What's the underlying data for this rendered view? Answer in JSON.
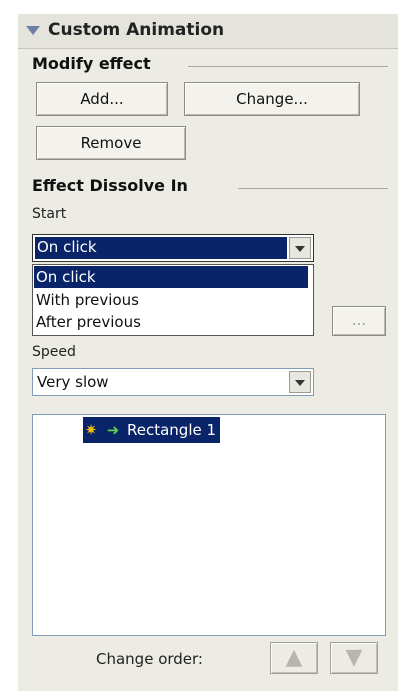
{
  "panel": {
    "title": "Custom Animation"
  },
  "modify_effect": {
    "title": "Modify effect",
    "add_button": "Add...",
    "change_button": "Change...",
    "remove_button": "Remove"
  },
  "effect": {
    "title": "Effect Dissolve In",
    "start_label": "Start",
    "start_value": "On click",
    "start_options": [
      "On click",
      "With previous",
      "After previous"
    ],
    "property_button": "...",
    "speed_label": "Speed",
    "speed_value": "Very slow"
  },
  "animation_list": {
    "items": [
      {
        "label": "Rectangle 1"
      }
    ]
  },
  "change_order": {
    "label": "Change order:",
    "up_icon": "arrow-up-icon",
    "down_icon": "arrow-down-icon"
  },
  "colors": {
    "selection": "#0a246a",
    "panel_bg": "#ecebe4"
  }
}
